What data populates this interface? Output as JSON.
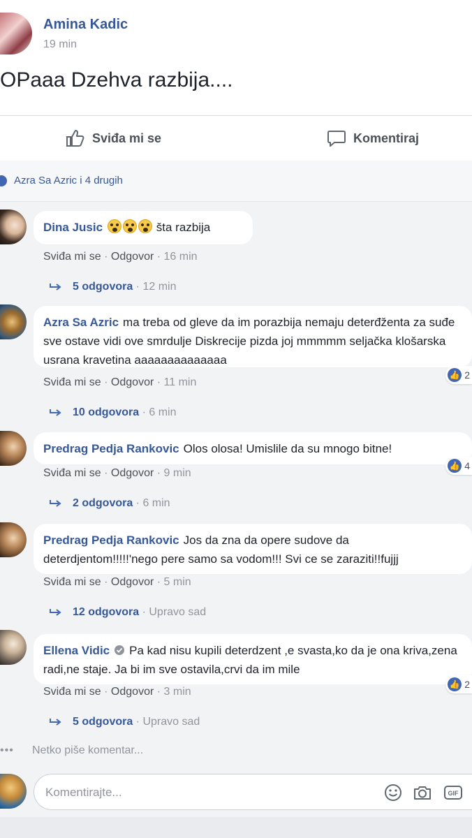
{
  "post": {
    "author": "Amina Kadic",
    "time": "19 min",
    "text": "OPaaa Dzehva razbija...."
  },
  "actions": {
    "like_label": "Sviđa mi se",
    "comment_label": "Komentiraj"
  },
  "reactions": {
    "text": "Azra Sa Azric i 4 drugih"
  },
  "comment_links": {
    "like": "Sviđa mi se",
    "reply": "Odgovor"
  },
  "comments": [
    {
      "author": "Dina Jusic",
      "emoji": [
        "scream-emoji",
        "scream-emoji",
        "scream-emoji"
      ],
      "text": "šta razbija",
      "time": "16 min",
      "replies": "5 odgovora",
      "replies_time": "12 min",
      "reaction_count": ""
    },
    {
      "author": "Azra Sa Azric",
      "text": "ma treba od gleve da im porazbija nemaju deterđženta za suđe sve ostave vidi ove smrdulje Diskrecije pizda joj mmmmm seljačka klošarska usrana kravetina aaaaaaaaaaaaaa",
      "time": "11 min",
      "replies": "10 odgovora",
      "replies_time": "6 min",
      "reaction_count": "2"
    },
    {
      "author": "Predrag Pedja Rankovic",
      "text": "Olos olosa! Umislile da su mnogo bitne!",
      "time": "9 min",
      "replies": "2 odgovora",
      "replies_time": "6 min",
      "reaction_count": "4"
    },
    {
      "author": "Predrag Pedja Rankovic",
      "text": "Jos da zna da opere sudove da deterdjentom!!!!!'nego pere samo sa vodom!!! Svi ce se zaraziti!!fujjj",
      "time": "5 min",
      "replies": "12 odgovora",
      "replies_time": "Upravo sad",
      "reaction_count": ""
    },
    {
      "author": "Ellena Vidic",
      "verified": true,
      "text": "Pa kad nisu kupili deterdzent ,e svasta,ko da je ona kriva,zena radi,ne staje. Ja bi im sve ostavila,crvi da im mile",
      "time": "3 min",
      "replies": "5 odgovora",
      "replies_time": "Upravo sad",
      "reaction_count": "2"
    }
  ],
  "typing": {
    "dots": "•••",
    "text": "Netko piše komentar..."
  },
  "composer": {
    "placeholder": "Komentirajte...",
    "icons": [
      "smiley-icon",
      "camera-icon",
      "gif-icon"
    ]
  },
  "colors": {
    "link_blue": "#365899",
    "like_blue": "#4267b2",
    "meta_gray": "#90949c",
    "comment_bg": "#f2f3f5"
  }
}
